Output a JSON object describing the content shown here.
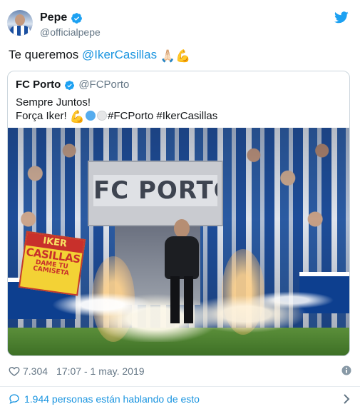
{
  "author": {
    "name": "Pepe",
    "handle": "@officialpepe",
    "verified": true,
    "avatar_icon": "avatar-pepe"
  },
  "platform_icon": "twitter-bird-icon",
  "tweet": {
    "text_prefix": "Te queremos ",
    "mention": "@IkerCasillas",
    "emoji_1": "🙏🏻",
    "emoji_2": "💪"
  },
  "quoted": {
    "name": "FC Porto",
    "handle": "@FCPorto",
    "verified": true,
    "line1": "Sempre Juntos!",
    "line2_prefix": "Força Iker! ",
    "emoji_muscle": "💪",
    "hashtags": "#FCPorto #IkerCasillas",
    "photo": {
      "tunnel_sign": "FC PORTO",
      "banner_head": "IKER",
      "banner_main": "CASILLAS",
      "banner_sub1": "DAME TU",
      "banner_sub2": "CAMISETA"
    }
  },
  "stats": {
    "likes": "7.304",
    "timestamp": "17:07 - 1 may. 2019"
  },
  "conversation": {
    "text": "1.944 personas están hablando de esto"
  },
  "colors": {
    "link": "#1b95e0",
    "text": "#14171a",
    "muted": "#657786",
    "border": "#ccd6dd"
  }
}
